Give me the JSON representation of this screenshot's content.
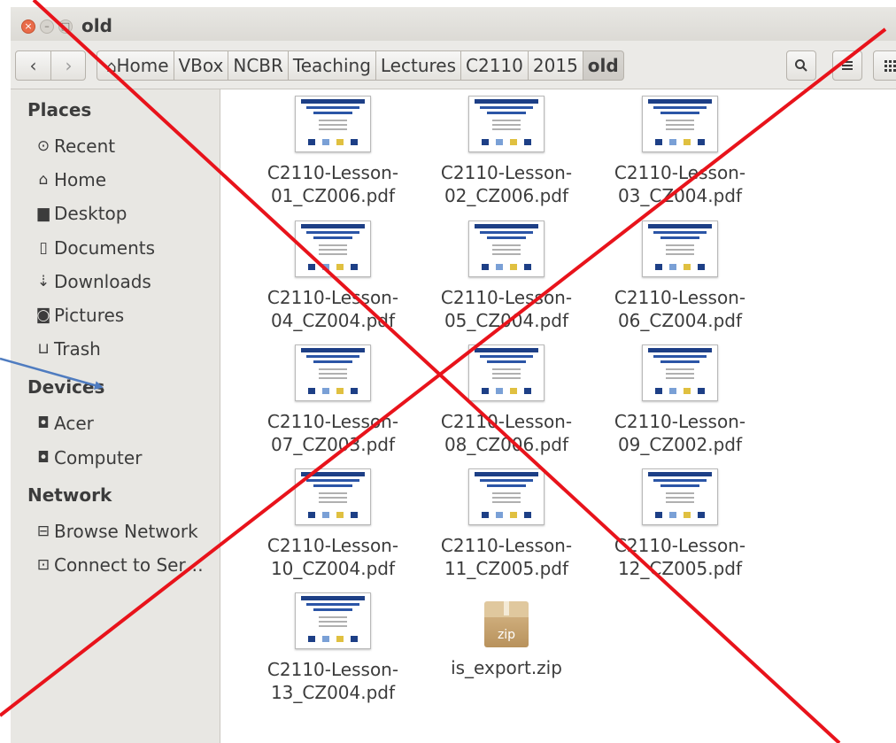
{
  "window": {
    "title": "old"
  },
  "breadcrumb": [
    "Home",
    "VBox",
    "NCBR",
    "Teaching",
    "Lectures",
    "C2110",
    "2015",
    "old"
  ],
  "sidebar": {
    "places_label": "Places",
    "places": [
      {
        "label": "Recent",
        "icon": "clock-icon"
      },
      {
        "label": "Home",
        "icon": "home-icon"
      },
      {
        "label": "Desktop",
        "icon": "folder-icon"
      },
      {
        "label": "Documents",
        "icon": "document-icon"
      },
      {
        "label": "Downloads",
        "icon": "download-icon"
      },
      {
        "label": "Pictures",
        "icon": "camera-icon"
      },
      {
        "label": "Trash",
        "icon": "trash-icon"
      }
    ],
    "devices_label": "Devices",
    "devices": [
      {
        "label": "Acer",
        "icon": "drive-icon"
      },
      {
        "label": "Computer",
        "icon": "drive-icon"
      }
    ],
    "network_label": "Network",
    "network": [
      {
        "label": "Browse Network",
        "icon": "network-icon"
      },
      {
        "label": "Connect to Ser…",
        "icon": "server-icon"
      }
    ]
  },
  "files": [
    {
      "line1": "C2110-Lesson-",
      "line2": "01_CZ006.pdf"
    },
    {
      "line1": "C2110-Lesson-",
      "line2": "02_CZ006.pdf"
    },
    {
      "line1": "C2110-Lesson-",
      "line2": "03_CZ004.pdf"
    },
    {
      "line1": "C2110-Lesson-",
      "line2": "04_CZ004.pdf"
    },
    {
      "line1": "C2110-Lesson-",
      "line2": "05_CZ004.pdf"
    },
    {
      "line1": "C2110-Lesson-",
      "line2": "06_CZ004.pdf"
    },
    {
      "line1": "C2110-Lesson-",
      "line2": "07_CZ003.pdf"
    },
    {
      "line1": "C2110-Lesson-",
      "line2": "08_CZ006.pdf"
    },
    {
      "line1": "C2110-Lesson-",
      "line2": "09_CZ002.pdf"
    },
    {
      "line1": "C2110-Lesson-",
      "line2": "10_CZ004.pdf"
    },
    {
      "line1": "C2110-Lesson-",
      "line2": "11_CZ005.pdf"
    },
    {
      "line1": "C2110-Lesson-",
      "line2": "12_CZ005.pdf"
    },
    {
      "line1": "C2110-Lesson-",
      "line2": "13_CZ004.pdf"
    },
    {
      "line1": "is_export.zip",
      "line2": "",
      "zip_label": "zip"
    }
  ],
  "colors": {
    "cross": "#e8131b",
    "arrow": "#4f7cc0",
    "close_button": "#e96b49",
    "thumbnail_header": "#1d3f86"
  }
}
